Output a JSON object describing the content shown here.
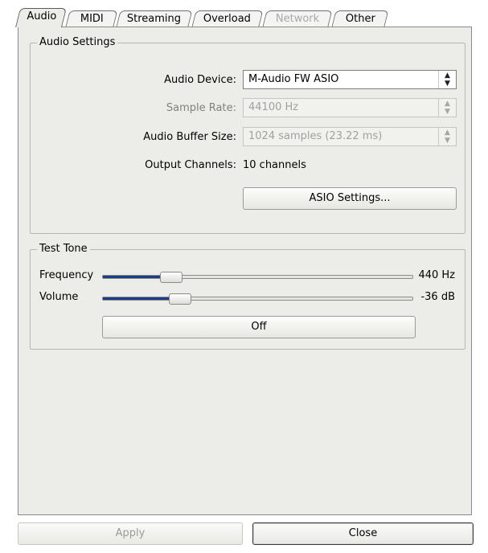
{
  "tabs": [
    {
      "label": "Audio",
      "active": true
    },
    {
      "label": "MIDI"
    },
    {
      "label": "Streaming"
    },
    {
      "label": "Overload"
    },
    {
      "label": "Network",
      "disabled": true
    },
    {
      "label": "Other"
    }
  ],
  "audio_settings": {
    "title": "Audio Settings",
    "audio_device_label": "Audio Device:",
    "audio_device_value": "M-Audio FW ASIO",
    "sample_rate_label": "Sample Rate:",
    "sample_rate_value": "44100 Hz",
    "buffer_size_label": "Audio Buffer Size:",
    "buffer_size_value": "1024 samples (23.22 ms)",
    "output_channels_label": "Output Channels:",
    "output_channels_value": "10 channels",
    "asio_button": "ASIO Settings..."
  },
  "test_tone": {
    "title": "Test Tone",
    "frequency_label": "Frequency",
    "frequency_value": "440 Hz",
    "frequency_fraction": 0.22,
    "volume_label": "Volume",
    "volume_value": "-36 dB",
    "volume_fraction": 0.25,
    "toggle_button": "Off"
  },
  "footer": {
    "apply": "Apply",
    "close": "Close"
  },
  "icons": {
    "combo_arrows": "up-down-arrows-icon"
  },
  "colors": {
    "panel_bg": "#ecece8",
    "slider_fill": "#1c3c86"
  }
}
